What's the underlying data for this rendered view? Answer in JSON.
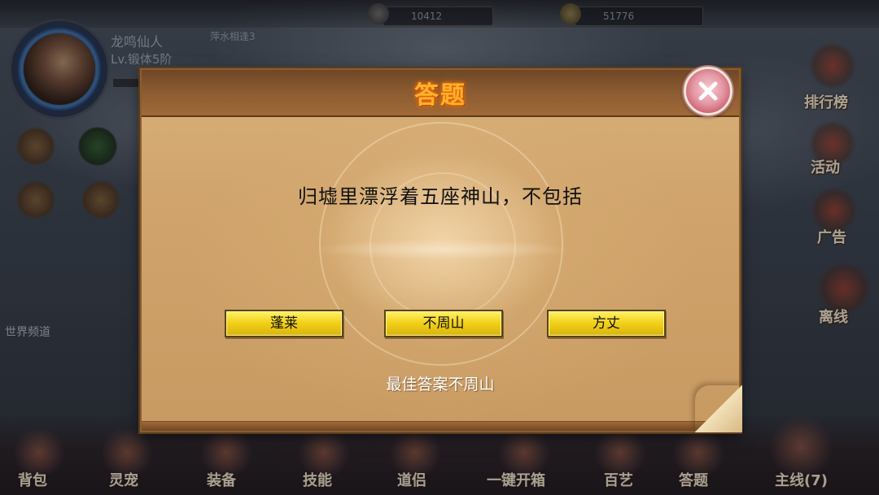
{
  "hud": {
    "resource_1": "10412",
    "resource_2": "51776",
    "player_name": "龙鸣仙人",
    "player_level": "Lv.锻体5阶",
    "player_tag": "萍水相逢3",
    "world_channel": "世界频道"
  },
  "right_menu": {
    "ranking": "排行榜",
    "activity": "活动",
    "ads": "广告",
    "offline": "离线"
  },
  "bottom_menu": {
    "bag": "背包",
    "pet": "灵宠",
    "equipment": "装备",
    "skills": "技能",
    "companion": "道侣",
    "open_all": "一键开箱",
    "crafts": "百艺",
    "quiz": "答题",
    "main_quest": "主线(7)"
  },
  "quiz_dialog": {
    "title": "答题",
    "question": "归墟里漂浮着五座神山，不包括",
    "answers": [
      "蓬莱",
      "不周山",
      "方丈"
    ],
    "best_answer": "最佳答案不周山"
  },
  "colors": {
    "title_glow": "#ffb12c",
    "answer_button": "#f3d21c",
    "close_button": "#e59aa6",
    "parchment": "#cfa36b"
  },
  "icons": {
    "close": "close-x-icon"
  }
}
